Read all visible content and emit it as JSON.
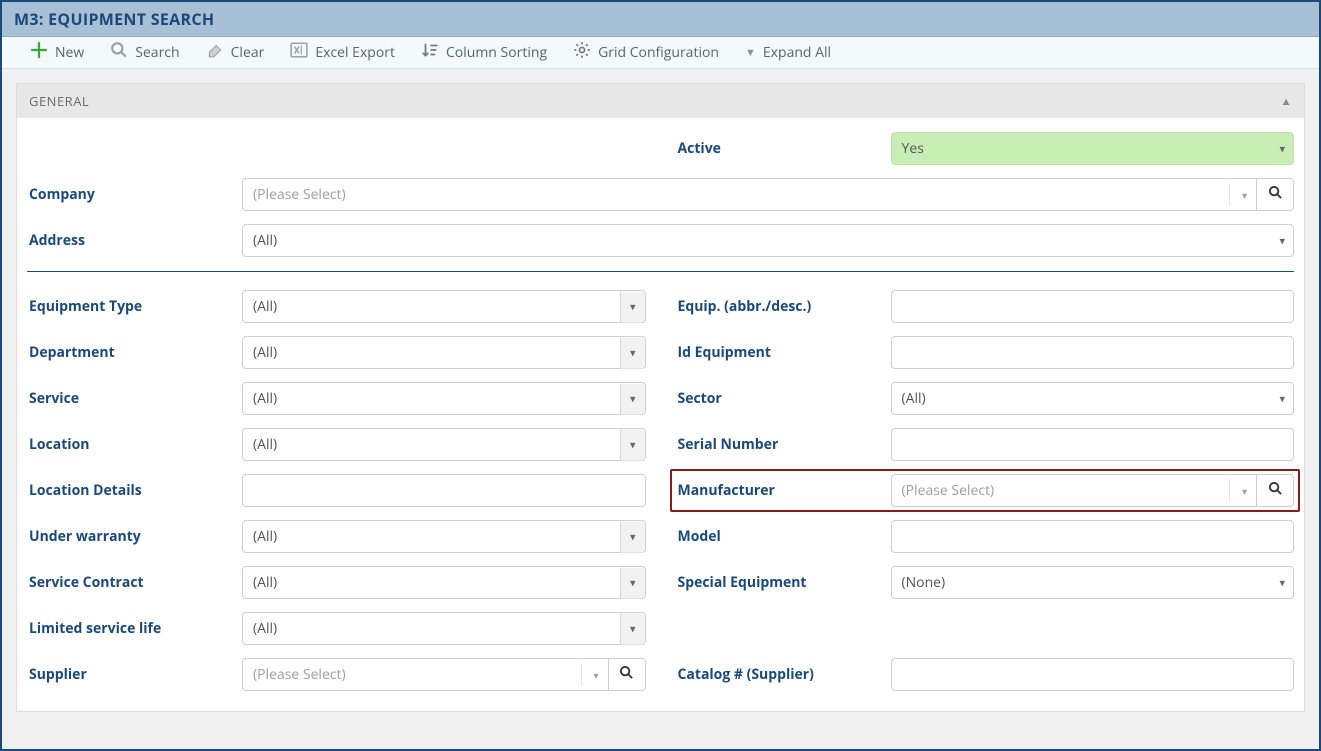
{
  "title": "M3: EQUIPMENT SEARCH",
  "toolbar": {
    "new_label": "New",
    "search_label": "Search",
    "clear_label": "Clear",
    "excel_label": "Excel Export",
    "sort_label": "Column Sorting",
    "grid_label": "Grid Configuration",
    "expand_label": "Expand All"
  },
  "panel": {
    "title": "GENERAL"
  },
  "placeholders": {
    "please_select": "(Please Select)",
    "all": "(All)",
    "none": "(None)"
  },
  "labels": {
    "active": "Active",
    "active_value": "Yes",
    "company": "Company",
    "address": "Address",
    "equipment_type": "Equipment Type",
    "department": "Department",
    "service": "Service",
    "location": "Location",
    "location_details": "Location Details",
    "under_warranty": "Under warranty",
    "service_contract": "Service Contract",
    "limited_service_life": "Limited service life",
    "supplier": "Supplier",
    "equip_abbr": "Equip. (abbr./desc.)",
    "id_equipment": "Id Equipment",
    "sector": "Sector",
    "serial_number": "Serial Number",
    "manufacturer": "Manufacturer",
    "model": "Model",
    "special_equipment": "Special Equipment",
    "catalog_supplier": "Catalog # (Supplier)"
  }
}
